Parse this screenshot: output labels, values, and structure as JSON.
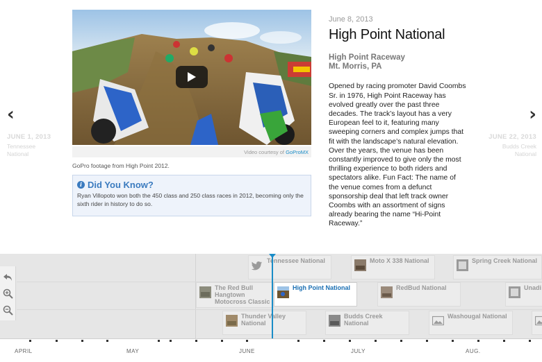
{
  "nav": {
    "prev": {
      "arrow": "‹",
      "date": "JUNE 1, 2013",
      "sub_line1": "Tennessee",
      "sub_line2": "National"
    },
    "next": {
      "arrow": "›",
      "date": "JUNE 22, 2013",
      "sub_line1": "Budds Creek",
      "sub_line2": "National"
    }
  },
  "media": {
    "credit_prefix": "Video courtesy of ",
    "credit_link": "GoProMX",
    "caption": "GoPro footage from High Point 2012."
  },
  "did_you_know": {
    "title": "Did You Know?",
    "text": "Ryan Villopoto won both the 450 class and 250 class races in 2012, becoming only the sixth rider in history to do so."
  },
  "slide": {
    "date": "June 8, 2013",
    "headline": "High Point National",
    "venue_line1": "High Point Raceway",
    "venue_line2": "Mt. Morris, PA",
    "body": "Opened by racing promoter David Coombs Sr. in 1976, High Point Raceway has evolved greatly over the past three decades. The track’s layout has a very European feel to it, featuring many sweeping corners and complex jumps that fit with the landscape’s natural elevation. Over the years, the venue has been constantly improved to give only the most thrilling experience to both riders and spectators alike. Fun Fact: The name of the venue comes from a defunct sponsorship deal that left track owner Coombs with an assortment of signs already bearing the name “Hi-Point Raceway.”"
  },
  "timeline": {
    "markers": {
      "tennessee": "Tennessee National",
      "motox338": "Moto X 338 National",
      "spring_creek": "Spring Creek National",
      "red_bull": "The Red Bull Hangtown Motocross Classic",
      "high_point": "High Point National",
      "redbud": "RedBud National",
      "unadilla": "Unadi",
      "thunder_valley": "Thunder Valley National",
      "budds_creek": "Budds Creek National",
      "washougal": "Washougal National"
    },
    "months": {
      "april": "APRIL",
      "may": "MAY",
      "june": "JUNE",
      "july": "JULY",
      "aug": "AUG."
    }
  },
  "colors": {
    "accent": "#1a8cc7",
    "active_label": "#1a6fb3",
    "dyk_title": "#3b7bbf"
  },
  "icons": {
    "prev": "chevron-left-icon",
    "next": "chevron-right-icon",
    "play": "play-icon",
    "back": "back-arrow-icon",
    "zoom_in": "zoom-in-icon",
    "zoom_out": "zoom-out-icon",
    "twitter": "twitter-icon"
  }
}
